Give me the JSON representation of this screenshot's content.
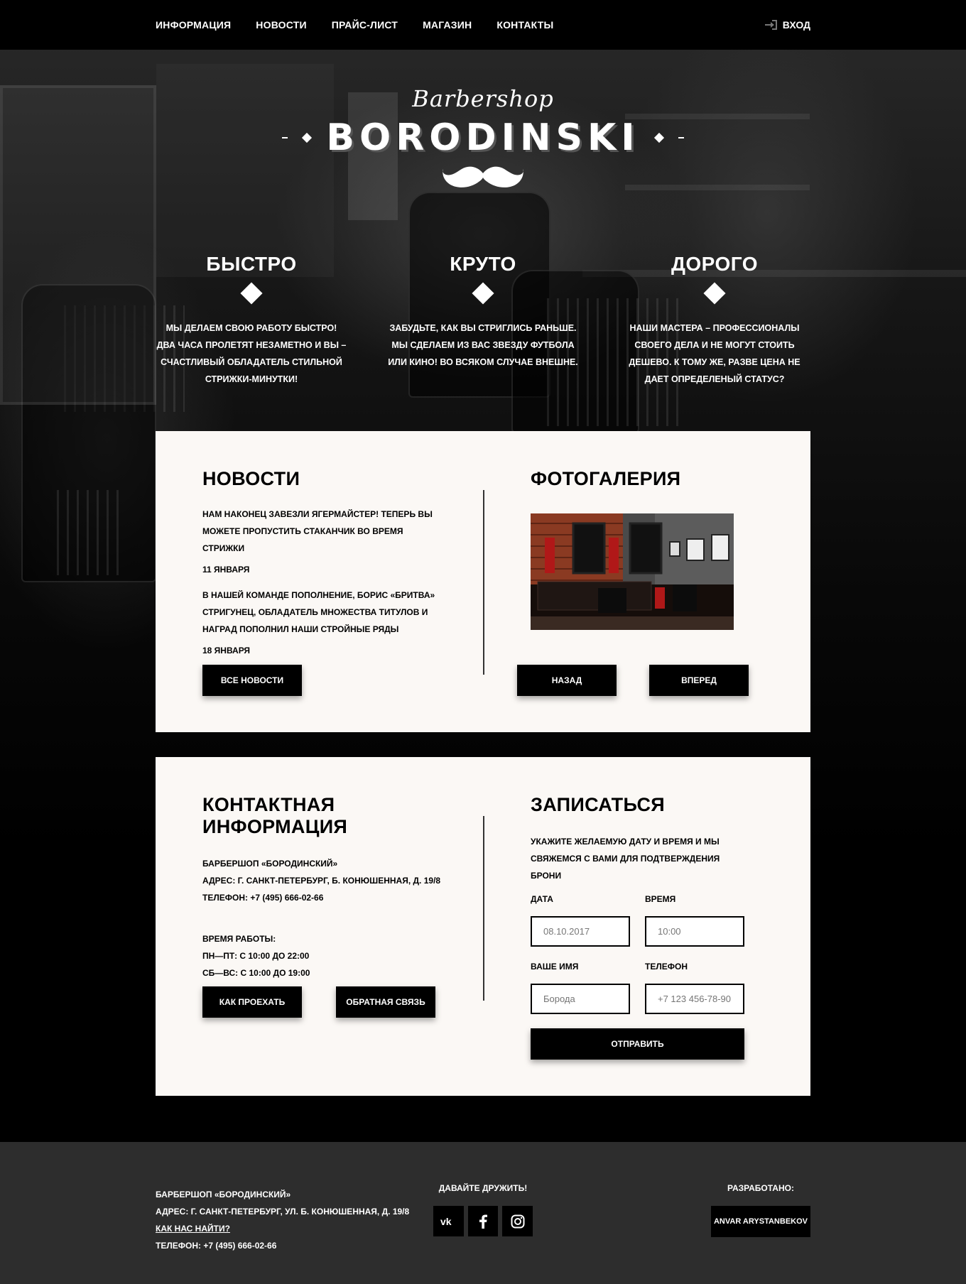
{
  "nav": {
    "items": [
      "ИНФОРМАЦИЯ",
      "НОВОСТИ",
      "ПРАЙС-ЛИСТ",
      "МАГАЗИН",
      "КОНТАКТЫ"
    ],
    "login_label": "ВХОД"
  },
  "logo": {
    "script": "Barbershop",
    "brand": "BORODINSKI"
  },
  "features": [
    {
      "title": "БЫСТРО",
      "text": "МЫ ДЕЛАЕМ СВОЮ РАБОТУ БЫСТРО! ДВА ЧАСА ПРОЛЕТЯТ НЕЗАМЕТНО И ВЫ – СЧАСТЛИВЫЙ ОБЛАДАТЕЛЬ СТИЛЬНОЙ СТРИЖКИ-МИНУТКИ!"
    },
    {
      "title": "КРУТО",
      "text": "ЗАБУДЬТЕ, КАК ВЫ СТРИГЛИСЬ РАНЬШЕ. МЫ СДЕЛАЕМ ИЗ ВАС ЗВЕЗДУ ФУТБОЛА ИЛИ КИНО! ВО ВСЯКОМ СЛУЧАЕ ВНЕШНЕ."
    },
    {
      "title": "ДОРОГО",
      "text": "НАШИ МАСТЕРА – ПРОФЕССИОНАЛЫ СВОЕГО ДЕЛА И НЕ МОГУТ СТОИТЬ ДЕШЕВО. К ТОМУ ЖЕ, РАЗВЕ ЦЕНА НЕ ДАЕТ ОПРЕДЕЛЕНЫЙ СТАТУС?"
    }
  ],
  "news": {
    "title": "НОВОСТИ",
    "items": [
      {
        "text": "НАМ НАКОНЕЦ ЗАВЕЗЛИ ЯГЕРМАЙСТЕР! ТЕПЕРЬ ВЫ МОЖЕТЕ ПРОПУСТИТЬ СТАКАНЧИК ВО ВРЕМЯ СТРИЖКИ",
        "date": "11 ЯНВАРЯ"
      },
      {
        "text": "В НАШЕЙ КОМАНДЕ ПОПОЛНЕНИЕ, БОРИС «БРИТВА» СТРИГУНЕЦ, ОБЛАДАТЕЛЬ МНОЖЕСТВА ТИТУЛОВ И НАГРАД ПОПОЛНИЛ НАШИ СТРОЙНЫЕ РЯДЫ",
        "date": "18 ЯНВАРЯ"
      }
    ],
    "all_button": "ВСЕ НОВОСТИ"
  },
  "gallery": {
    "title": "ФОТОГАЛЕРИЯ",
    "prev_button": "НАЗАД",
    "next_button": "ВПЕРЕД"
  },
  "contact": {
    "title": "КОНТАКТНАЯ ИНФОРМАЦИЯ",
    "name": "БАРБЕРШОП «БОРОДИНСКИЙ»",
    "address": "АДРЕС: Г. САНКТ-ПЕТЕРБУРГ, Б. КОНЮШЕННАЯ, Д. 19/8",
    "phone": "ТЕЛЕФОН: +7 (495) 666-02-66",
    "hours_title": "ВРЕМЯ РАБОТЫ:",
    "hours_weekdays": "ПН—ПТ: С 10:00 ДО 22:00",
    "hours_weekend": "СБ—ВС: С 10:00 ДО 19:00",
    "route_button": "КАК ПРОЕХАТЬ",
    "feedback_button": "ОБРАТНАЯ СВЯЗЬ"
  },
  "booking": {
    "title": "ЗАПИСАТЬСЯ",
    "intro": "УКАЖИТЕ ЖЕЛАЕМУЮ ДАТУ И ВРЕМЯ И МЫ СВЯЖЕМСЯ С ВАМИ ДЛЯ ПОДТВЕРЖДЕНИЯ БРОНИ",
    "date_label": "ДАТА",
    "date_value": "08.10.2017",
    "time_label": "ВРЕМЯ",
    "time_value": "10:00",
    "name_label": "ВАШЕ ИМЯ",
    "name_placeholder": "Борода",
    "phone_label": "ТЕЛЕФОН",
    "phone_placeholder": "+7 123 456-78-90",
    "submit": "ОТПРАВИТЬ"
  },
  "footer": {
    "name": "БАРБЕРШОП «БОРОДИНСКИЙ»",
    "address": "АДРЕС: Г. САНКТ-ПЕТЕРБУРГ, УЛ. Б. КОНЮШЕННАЯ, Д. 19/8",
    "find_link": "КАК НАС НАЙТИ?",
    "phone": "ТЕЛЕФОН: +7 (495) 666-02-66",
    "social_title": "ДАВАЙТЕ ДРУЖИТЬ!",
    "social_icons": [
      "vk-icon",
      "facebook-icon",
      "instagram-icon"
    ],
    "dev_title": "РАЗРАБОТАНО:",
    "dev_name": "ANVAR ARYSTANBEKOV"
  }
}
